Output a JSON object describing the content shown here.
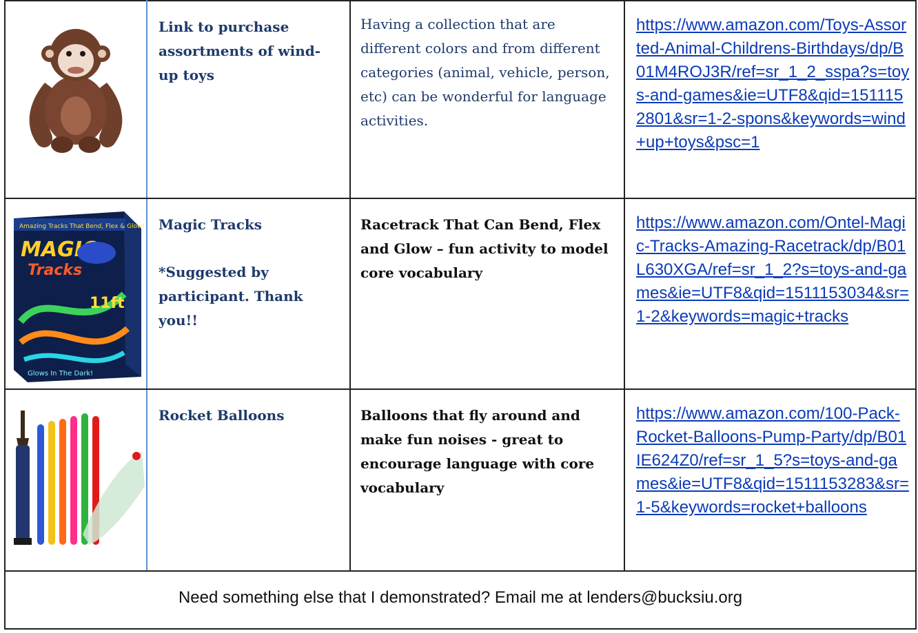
{
  "rows": [
    {
      "image_icon": "monkey-toy-image",
      "name": "Link to purchase assortments of wind-up toys",
      "note": "",
      "description": "Having a collection that are different colors and from different categories (animal, vehicle, person, etc) can be wonderful for language activities.",
      "description_style": "plain",
      "url": "https://www.amazon.com/Toys-Assorted-Animal-Childrens-Birthdays/dp/B01M4ROJ3R/ref=sr_1_2_sspa?s=toys-and-games&ie=UTF8&qid=1511152801&sr=1-2-spons&keywords=wind+up+toys&psc=1"
    },
    {
      "image_icon": "magic-tracks-box-image",
      "name": "Magic Tracks",
      "note": "*Suggested by participant. Thank you!!",
      "description": "Racetrack That Can Bend, Flex and Glow – fun activity to model core vocabulary",
      "description_style": "bold",
      "url": "https://www.amazon.com/Ontel-Magic-Tracks-Amazing-Racetrack/dp/B01L630XGA/ref=sr_1_2?s=toys-and-games&ie=UTF8&qid=1511153034&sr=1-2&keywords=magic+tracks"
    },
    {
      "image_icon": "rocket-balloons-image",
      "name": "Rocket Balloons",
      "note": "",
      "description": "Balloons that fly around and make fun noises - great to encourage language with core vocabulary",
      "description_style": "bold",
      "url": "https://www.amazon.com/100-Pack-Rocket-Balloons-Pump-Party/dp/B01IE624Z0/ref=sr_1_5?s=toys-and-games&ie=UTF8&qid=1511153283&sr=1-5&keywords=rocket+balloons"
    }
  ],
  "footer": {
    "text": "Need something else that I demonstrated? Email me at lenders@bucksiu.org"
  },
  "colors": {
    "heading_blue": "#1f3a6b",
    "link_blue": "#0b3bb8",
    "column_divider_blue": "#5b8fd0"
  }
}
